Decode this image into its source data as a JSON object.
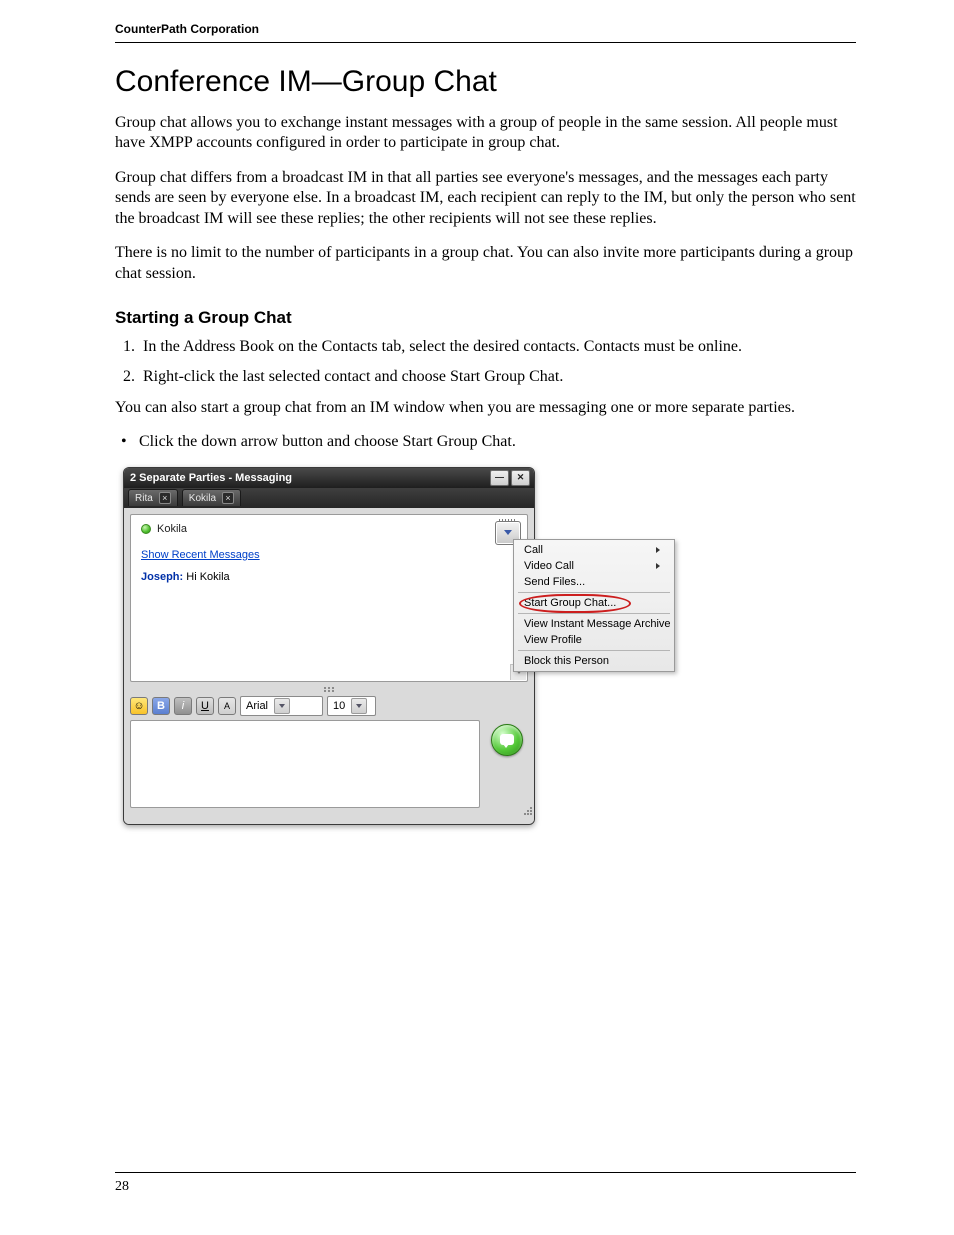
{
  "header": {
    "running": "CounterPath Corporation"
  },
  "title": "Conference IM—Group Chat",
  "paras": {
    "p1": "Group chat allows you to exchange instant messages with a group of people in the same session. All people must have XMPP accounts configured in order to participate in group chat.",
    "p2": "Group chat differs from a broadcast IM in that all parties see everyone's messages, and the messages each party sends are seen by everyone else. In a broadcast IM, each recipient can reply to the IM, but only the person who sent the broadcast IM will see these replies; the other recipients will not see these replies.",
    "p3": "There is no limit to the number of participants in a group chat. You can also invite more participants during a group chat session."
  },
  "subhead": "Starting a Group Chat",
  "steps": {
    "s1": "In the Address Book on the Contacts tab, select the desired contacts. Contacts must be online.",
    "s2": "Right-click the last selected contact and choose Start Group Chat."
  },
  "post_steps": "You can also start a group chat from an IM window when you are messaging one or more separate parties.",
  "bullet": "Click the down arrow button and choose Start Group Chat.",
  "page_number": "28",
  "app": {
    "window_title": "2 Separate Parties - Messaging",
    "tabs": [
      {
        "label": "Rita"
      },
      {
        "label": "Kokila"
      }
    ],
    "contact_name": "Kokila",
    "recent_link": "Show Recent Messages",
    "message_sender": "Joseph:",
    "message_text": " Hi Kokila",
    "font_name": "Arial",
    "font_size": "10",
    "toolbar": {
      "emoji": "☺",
      "bold": "B",
      "italic": "i",
      "underline": "U",
      "color": "A"
    }
  },
  "menu": {
    "items": [
      {
        "label": "Call",
        "submenu": true
      },
      {
        "label": "Video Call",
        "submenu": true
      },
      {
        "label": "Send Files...",
        "submenu": false
      },
      {
        "label": "Start Group Chat...",
        "submenu": false,
        "highlight": true
      },
      {
        "label": "View Instant Message Archive",
        "submenu": false
      },
      {
        "label": "View Profile",
        "submenu": false
      },
      {
        "label": "Block this Person",
        "submenu": false
      }
    ]
  }
}
